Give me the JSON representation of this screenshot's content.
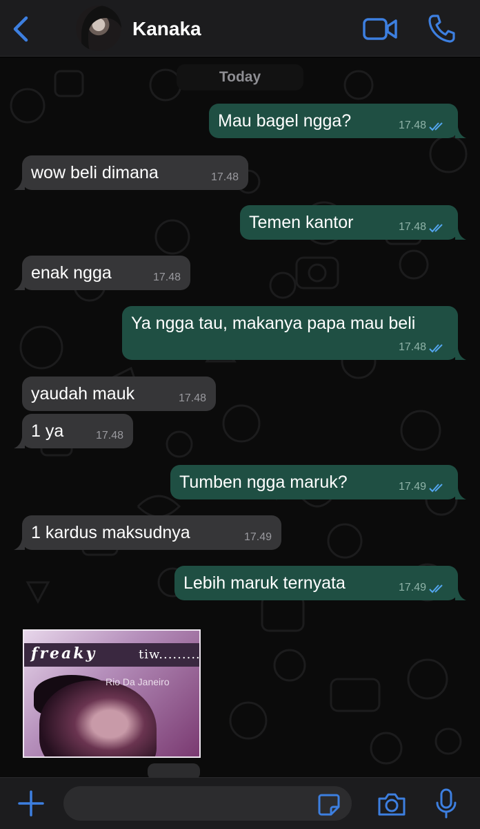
{
  "header": {
    "contact_name": "Kanaka",
    "back_icon": "chevron-left-icon",
    "video_icon": "video-camera-icon",
    "call_icon": "phone-icon",
    "accent_color": "#3d7fe0"
  },
  "chat": {
    "date_label": "Today",
    "messages": [
      {
        "direction": "out",
        "text": "Mau bagel ngga?",
        "time": "17.48",
        "status": "read"
      },
      {
        "direction": "in",
        "text": "wow beli dimana",
        "time": "17.48"
      },
      {
        "direction": "out",
        "text": "Temen kantor",
        "time": "17.48",
        "status": "read"
      },
      {
        "direction": "in",
        "text": "enak ngga",
        "time": "17.48"
      },
      {
        "direction": "out",
        "text": "Ya ngga tau, makanya papa mau beli",
        "time": "17.48",
        "status": "read"
      },
      {
        "direction": "in",
        "text": "yaudah mauk",
        "time": "17.48"
      },
      {
        "direction": "in",
        "text": "1 ya",
        "time": "17.48"
      },
      {
        "direction": "out",
        "text": "Tumben ngga maruk?",
        "time": "17.49",
        "status": "read"
      },
      {
        "direction": "in",
        "text": "1 kardus maksudnya",
        "time": "17.49"
      },
      {
        "direction": "out",
        "text": "Lebih maruk ternyata",
        "time": "17.49",
        "status": "read"
      }
    ],
    "sticker": {
      "title": "freaky",
      "subtitle": "tiw.........",
      "name": "Rio Da Janeiro"
    }
  },
  "composer": {
    "input_value": "",
    "plus_icon": "plus-icon",
    "sticker_icon": "sticker-icon",
    "camera_icon": "camera-icon",
    "mic_icon": "microphone-icon"
  },
  "colors": {
    "outgoing_bubble": "#1f4f43",
    "incoming_bubble": "#363638",
    "read_ticks": "#53a6f0"
  }
}
